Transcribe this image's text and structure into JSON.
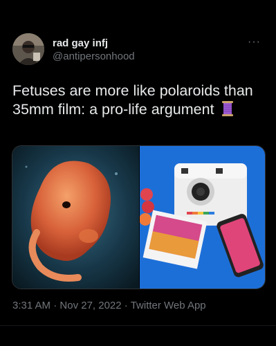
{
  "user": {
    "display_name": "rad gay infj",
    "handle": "@antipersonhood"
  },
  "tweet": {
    "text": "Fetuses are more like polaroids than 35mm film: a pro-life argument",
    "emoji": "thread-spool-icon"
  },
  "media": {
    "left_image": "embryo-photo",
    "right_image": "polaroid-camera-photo"
  },
  "meta": {
    "time": "3:31 AM",
    "date": "Nov 27, 2022",
    "source": "Twitter Web App",
    "separator": "·"
  },
  "menu": {
    "more": "···"
  },
  "colors": {
    "background": "#000000",
    "text": "#e7e9ea",
    "secondary": "#71767b"
  }
}
